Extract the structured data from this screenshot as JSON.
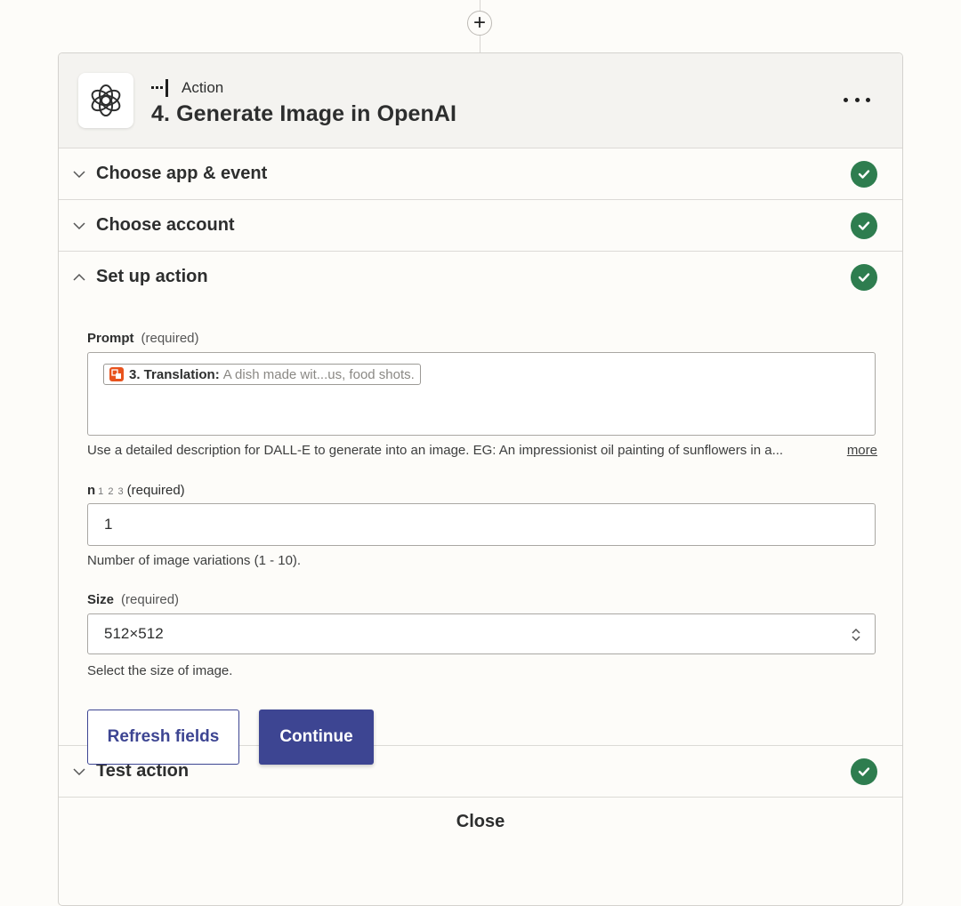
{
  "connector": {
    "add_glyph": "+"
  },
  "header": {
    "step_type": "Action",
    "title": "4. Generate Image in OpenAI",
    "app_icon": "openai-logo-icon",
    "more_icon": "more-horizontal-icon"
  },
  "sections": {
    "choose_app": {
      "label": "Choose app & event",
      "status": "complete"
    },
    "choose_account": {
      "label": "Choose account",
      "status": "complete"
    },
    "setup": {
      "label": "Set up action",
      "status": "complete",
      "expanded": true
    },
    "test": {
      "label": "Test action",
      "status": "complete"
    }
  },
  "fields": {
    "prompt": {
      "label": "Prompt",
      "required": "(required)",
      "pill_step": "3. Translation:",
      "pill_value": "A dish made wit...us, food shots.",
      "help": "Use a detailed description for DALL-E to generate into an image. EG: An impressionist oil painting of sunflowers in a...",
      "more": "more"
    },
    "n": {
      "label": "n",
      "type_hint": "1 2 3",
      "required": "(required)",
      "value": "1",
      "help": "Number of image variations (1 - 10)."
    },
    "size": {
      "label": "Size",
      "required": "(required)",
      "value": "512×512",
      "help": "Select the size of image."
    }
  },
  "buttons": {
    "refresh": "Refresh fields",
    "continue": "Continue",
    "close": "Close"
  },
  "colors": {
    "success": "#2e7d4f",
    "primary": "#3d4592",
    "pill_icon": "#e8531d"
  }
}
